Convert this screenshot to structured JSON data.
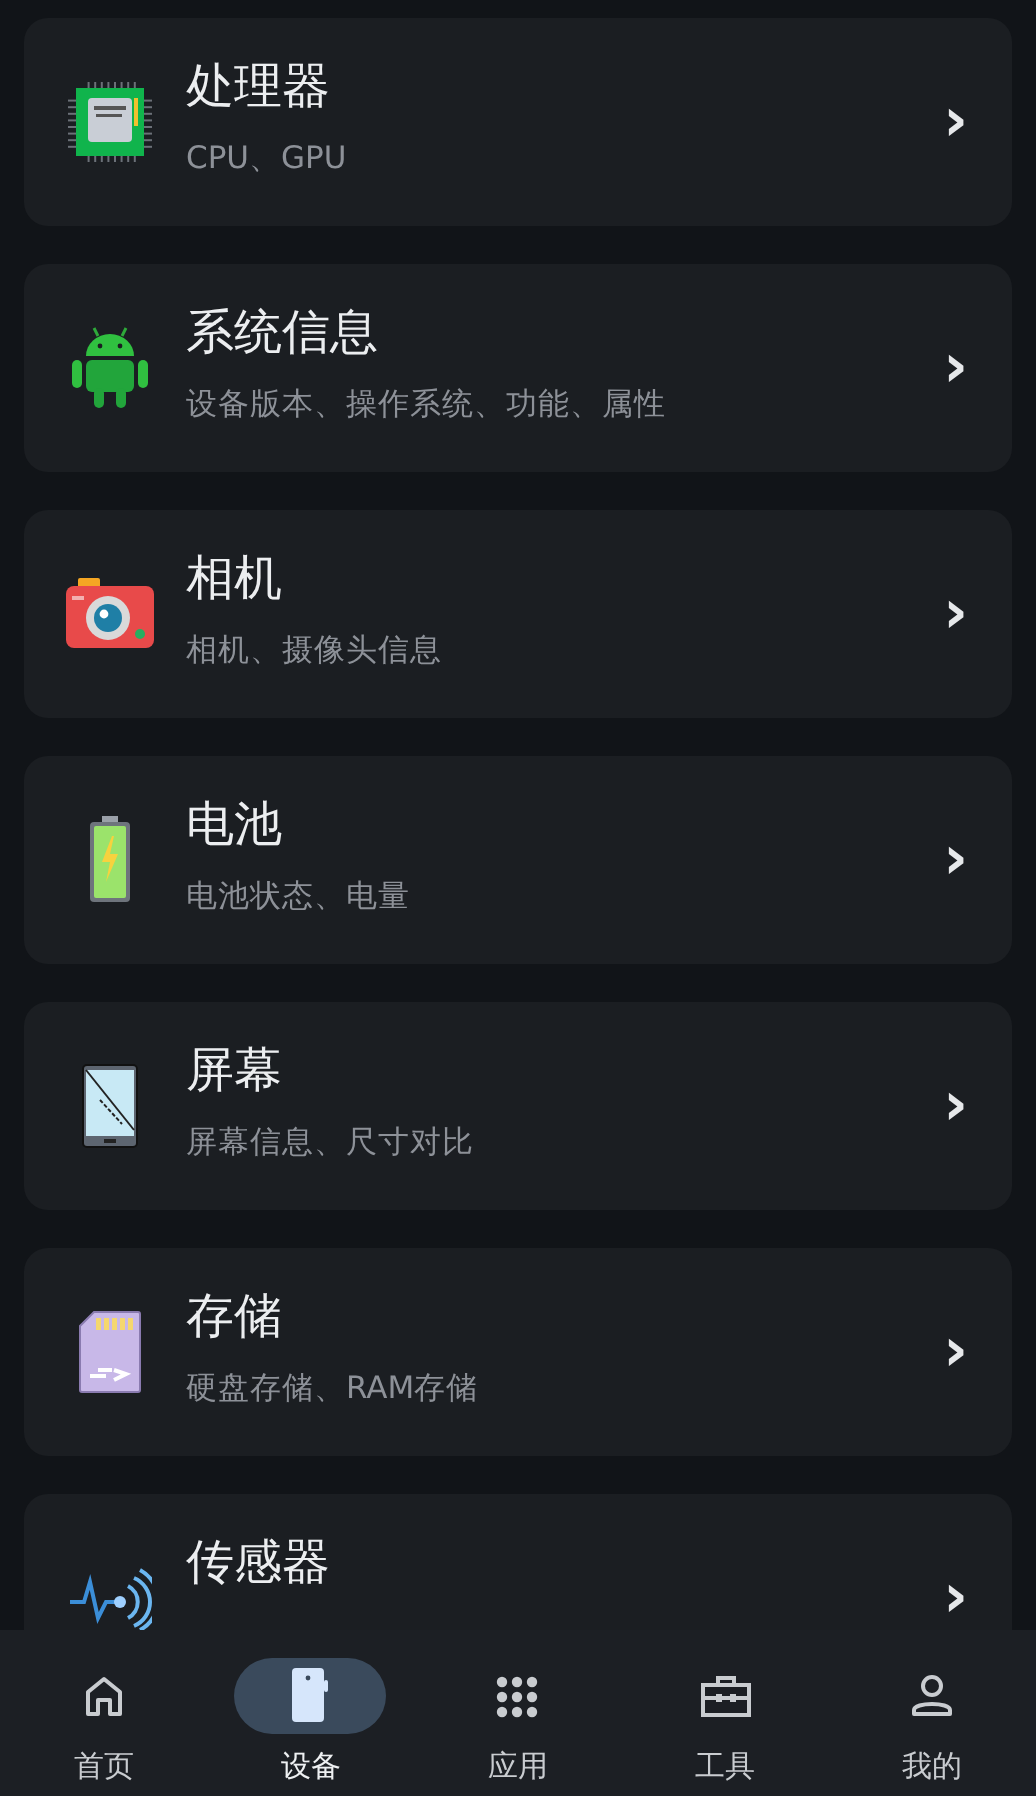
{
  "items": [
    {
      "kind": "cpu",
      "title": "处理器",
      "subtitle": "CPU、GPU",
      "chevron": "›"
    },
    {
      "kind": "robot",
      "title": "系统信息",
      "subtitle": "设备版本、操作系统、功能、属性",
      "chevron": "›"
    },
    {
      "kind": "camera",
      "title": "相机",
      "subtitle": "相机、摄像头信息",
      "chevron": "›"
    },
    {
      "kind": "battery",
      "title": "电池",
      "subtitle": "电池状态、电量",
      "chevron": "›"
    },
    {
      "kind": "phone",
      "title": "屏幕",
      "subtitle": "屏幕信息、尺寸对比",
      "chevron": "›"
    },
    {
      "kind": "sdcard",
      "title": "存储",
      "subtitle": "硬盘存储、RAM存储",
      "chevron": "›"
    },
    {
      "kind": "sensor",
      "title": "传感器",
      "chevron": "›"
    }
  ],
  "nav": [
    {
      "kind": "home",
      "label": "首页",
      "selected": false
    },
    {
      "kind": "device",
      "label": "设备",
      "selected": true
    },
    {
      "kind": "apps",
      "label": "应用",
      "selected": false
    },
    {
      "kind": "tools",
      "label": "工具",
      "selected": false
    },
    {
      "kind": "profile",
      "label": "我的",
      "selected": false
    }
  ]
}
